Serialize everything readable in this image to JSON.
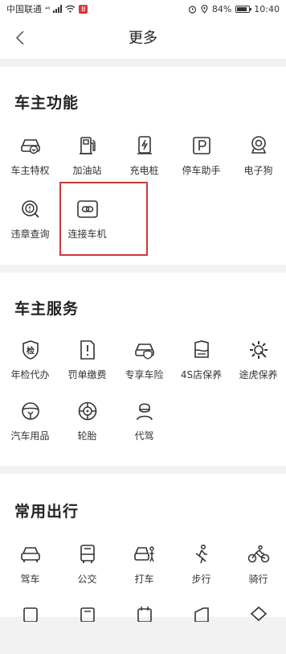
{
  "status_bar": {
    "carrier": "中国联通",
    "network_label": "⁴⁶",
    "notif_badge": "B",
    "battery_pct": "84%",
    "time": "10:40",
    "battery_level": 0.84
  },
  "header": {
    "title": "更多"
  },
  "sections": [
    {
      "title": "车主功能",
      "items": [
        {
          "label": "车主特权",
          "icon": "car-privilege-icon"
        },
        {
          "label": "加油站",
          "icon": "gas-station-icon"
        },
        {
          "label": "充电桩",
          "icon": "charging-pile-icon"
        },
        {
          "label": "停车助手",
          "icon": "parking-icon"
        },
        {
          "label": "电子狗",
          "icon": "camera-icon"
        },
        {
          "label": "违章查询",
          "icon": "violation-search-icon"
        },
        {
          "label": "连接车机",
          "icon": "link-icon"
        }
      ]
    },
    {
      "title": "车主服务",
      "items": [
        {
          "label": "年检代办",
          "icon": "inspection-shield-icon",
          "glyph": "检"
        },
        {
          "label": "罚单缴费",
          "icon": "ticket-fine-icon"
        },
        {
          "label": "专享车险",
          "icon": "car-insurance-icon"
        },
        {
          "label": "4S店保养",
          "icon": "dealer-service-icon"
        },
        {
          "label": "途虎保养",
          "icon": "gear-wrench-icon"
        },
        {
          "label": "汽车用品",
          "icon": "steering-wheel-icon"
        },
        {
          "label": "轮胎",
          "icon": "tire-icon"
        },
        {
          "label": "代驾",
          "icon": "driver-icon"
        }
      ]
    },
    {
      "title": "常用出行",
      "items": [
        {
          "label": "驾车",
          "icon": "car-icon"
        },
        {
          "label": "公交",
          "icon": "bus-icon"
        },
        {
          "label": "打车",
          "icon": "taxi-icon"
        },
        {
          "label": "步行",
          "icon": "walk-icon"
        },
        {
          "label": "骑行",
          "icon": "bike-icon"
        }
      ]
    }
  ]
}
